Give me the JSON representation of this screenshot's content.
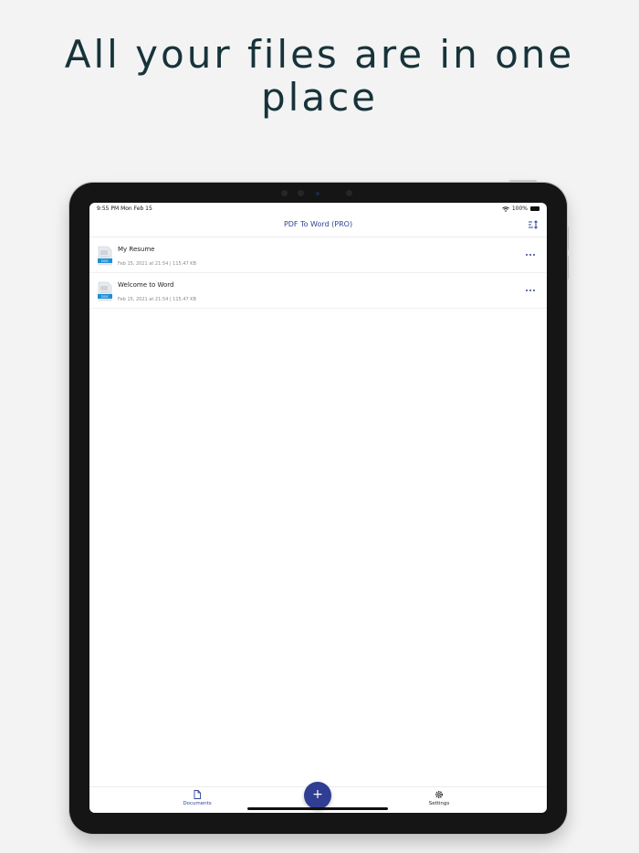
{
  "headline": {
    "line1": "All your files are in one",
    "line2": "place"
  },
  "status_bar": {
    "time_date": "9:55 PM  Mon Feb 15",
    "battery": "100%",
    "wifi_icon": "wifi-icon",
    "battery_icon": "battery-icon"
  },
  "nav": {
    "title": "PDF To Word (PRO)",
    "sort_icon": "sort-icon"
  },
  "documents": [
    {
      "name": "My Resume",
      "meta": "Feb 15, 2021 at 21:54  |  115.47 KB",
      "badge": "DOC"
    },
    {
      "name": "Welcome to Word",
      "meta": "Feb 15, 2021 at 21:54  |  115.47 KB",
      "badge": "DOC"
    }
  ],
  "tabbar": {
    "documents_label": "Documents",
    "settings_label": "Settings",
    "add_label": "+"
  },
  "colors": {
    "accent": "#2f4596",
    "fab": "#2f3d93",
    "headline": "#17333a",
    "background": "#f3f3f3",
    "doc_badge": "#1e8fd6"
  }
}
